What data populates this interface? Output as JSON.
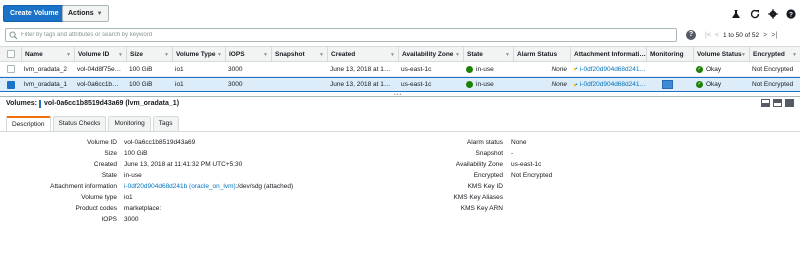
{
  "toolbar": {
    "create_label": "Create Volume",
    "actions_label": "Actions",
    "icons": [
      "flask-icon",
      "refresh-icon",
      "gear-icon",
      "help-icon"
    ]
  },
  "filter": {
    "placeholder": "Filter by tags and attributes or search by keyword",
    "help": "?",
    "pager_text": "1 to 50 of 52"
  },
  "table": {
    "columns": [
      "Name",
      "Volume ID",
      "Size",
      "Volume Type",
      "IOPS",
      "Snapshot",
      "Created",
      "Availability Zone",
      "State",
      "Alarm Status",
      "Attachment Informati…",
      "Monitoring",
      "Volume Status",
      "Encrypted"
    ],
    "rows": [
      {
        "name": "lvm_oradata_2",
        "volume_id": "vol-04d8f75e…",
        "size": "100 GiB",
        "type": "io1",
        "iops": "3000",
        "snapshot": "",
        "created": "June 13, 2018 at 1…",
        "az": "us-east-1c",
        "state": "in-use",
        "alarm": "None",
        "attachment": "i-0df20d904d68d241…",
        "status": "Okay",
        "encrypted": "Not Encrypted",
        "selected": false
      },
      {
        "name": "lvm_oradata_1",
        "volume_id": "vol-0a6cc1b…",
        "size": "100 GiB",
        "type": "io1",
        "iops": "3000",
        "snapshot": "",
        "created": "June 13, 2018 at 1…",
        "az": "us-east-1c",
        "state": "in-use",
        "alarm": "None",
        "attachment": "i-0df20d904d68d241…",
        "status": "Okay",
        "encrypted": "Not Encrypted",
        "selected": true
      }
    ]
  },
  "details": {
    "prefix": "Volumes:",
    "title": "vol-0a6cc1b8519d43a69 (lvm_oradata_1)",
    "tabs": [
      "Description",
      "Status Checks",
      "Monitoring",
      "Tags"
    ],
    "left": [
      {
        "k": "Volume ID",
        "v": "vol-0a6cc1b8519d43a69"
      },
      {
        "k": "Size",
        "v": "100 GiB"
      },
      {
        "k": "Created",
        "v": "June 13, 2018 at 11:41:32 PM UTC+5:30"
      },
      {
        "k": "State",
        "v": "in-use"
      },
      {
        "k": "Attachment information",
        "v_link": "i-0df20d904d68d241b (oracle_on_lvm)",
        "v": ":/dev/sdg (attached)"
      },
      {
        "k": "Volume type",
        "v": "io1"
      },
      {
        "k": "Product codes",
        "v": "marketplace:"
      },
      {
        "k": "IOPS",
        "v": "3000"
      }
    ],
    "right": [
      {
        "k": "Alarm status",
        "v": "None"
      },
      {
        "k": "Snapshot",
        "v": "-"
      },
      {
        "k": "Availability Zone",
        "v": "us-east-1c"
      },
      {
        "k": "Encrypted",
        "v": "Not Encrypted"
      },
      {
        "k": "KMS Key ID",
        "v": ""
      },
      {
        "k": "KMS Key Aliases",
        "v": ""
      },
      {
        "k": "KMS Key ARN",
        "v": ""
      }
    ]
  },
  "colors": {
    "primary": "#1a73c8",
    "link": "#0073bb",
    "ok_green": "#1d8102",
    "tab_accent": "#ec7211",
    "selected_row": "#dcecf8"
  }
}
